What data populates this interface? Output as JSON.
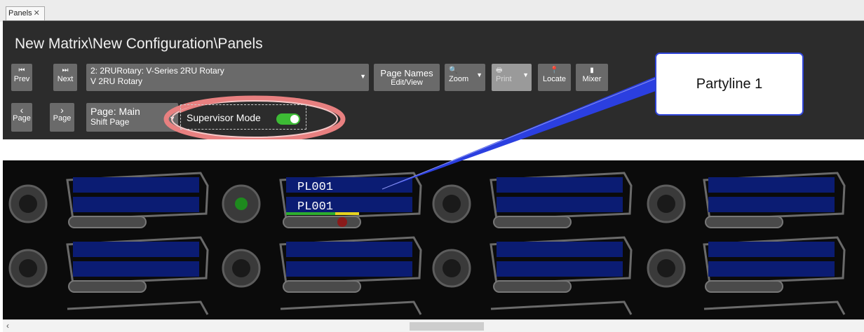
{
  "tab": {
    "label": "Panels",
    "close": "✕"
  },
  "title": "New Matrix\\New Configuration\\Panels",
  "toolbar": {
    "prev": {
      "icon": "⏮",
      "label": "Prev"
    },
    "next": {
      "icon": "⏭",
      "label": "Next"
    },
    "panel_select": {
      "line1": "2: 2RURotary: V-Series 2RU Rotary",
      "line2": "V 2RU Rotary"
    },
    "page_names": {
      "line1": "Page Names",
      "line2": "Edit/View"
    },
    "zoom": {
      "icon": "🔍",
      "label": "Zoom"
    },
    "print": {
      "icon": "🖶",
      "label": "Print"
    },
    "locate": {
      "icon": "📍",
      "label": "Locate"
    },
    "mixer": {
      "icon": "▮",
      "label": "Mixer"
    },
    "page_prev": {
      "icon": "‹",
      "label": "Page"
    },
    "page_next": {
      "icon": "›",
      "label": "Page"
    },
    "page_select": {
      "line1": "Page: Main",
      "line2": "Shift Page"
    },
    "supervisor_mode": {
      "label": "Supervisor Mode",
      "enabled": true
    }
  },
  "panel_keys": {
    "active_key": {
      "line1": "PL001",
      "line2": "PL001",
      "led_color": "#1e8a1e"
    }
  },
  "callout": {
    "text": "Partyline 1"
  },
  "colors": {
    "accent_toggle": "#3dbb35",
    "callout_line": "#2b3fe0",
    "ring": "#e88080"
  }
}
